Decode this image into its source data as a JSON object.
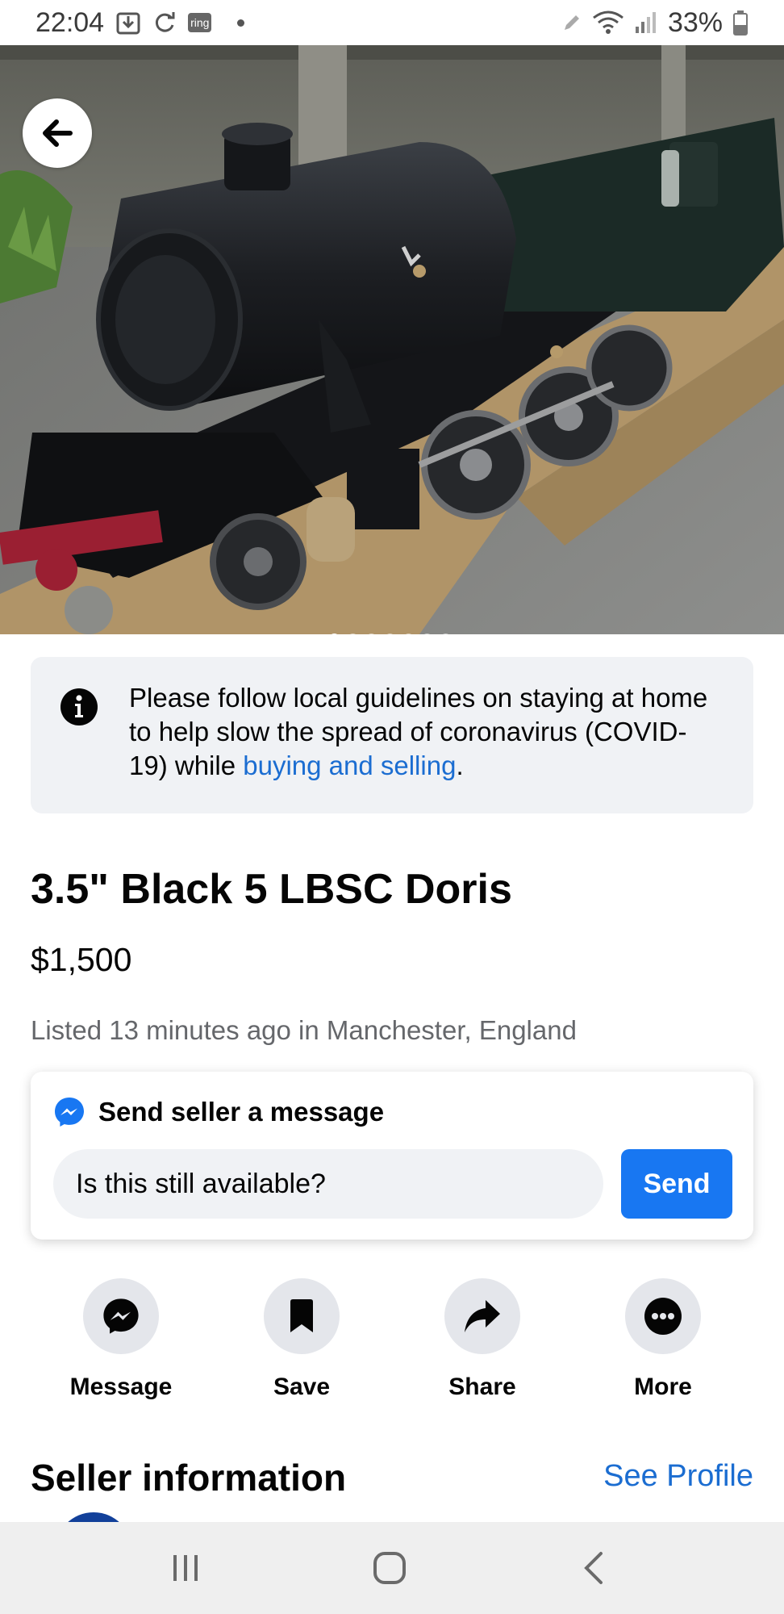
{
  "status_bar": {
    "time": "22:04",
    "ring_label": "ring",
    "battery": "33%"
  },
  "hero": {
    "image_count": 7,
    "active_index": 0
  },
  "notice": {
    "text_before": "Please follow local guidelines on staying at home to help slow the spread of coronavirus (COVID-19) while ",
    "link_text": "buying and selling",
    "text_after": "."
  },
  "listing": {
    "title": "3.5\" Black 5 LBSC Doris",
    "price": "$1,500",
    "listed": "Listed 13 minutes ago in Manchester, England"
  },
  "message": {
    "header": "Send seller a message",
    "input_value": "Is this still available?",
    "send_label": "Send"
  },
  "actions": [
    {
      "label": "Message",
      "icon": "messenger-icon"
    },
    {
      "label": "Save",
      "icon": "bookmark-icon"
    },
    {
      "label": "Share",
      "icon": "share-arrow-icon"
    },
    {
      "label": "More",
      "icon": "more-dots-icon"
    }
  ],
  "seller": {
    "title": "Seller information",
    "see_profile": "See Profile"
  },
  "colors": {
    "accent": "#1877f2",
    "link": "#1b6dd1",
    "secondary_text": "#65676b",
    "surface": "#f0f2f5"
  }
}
